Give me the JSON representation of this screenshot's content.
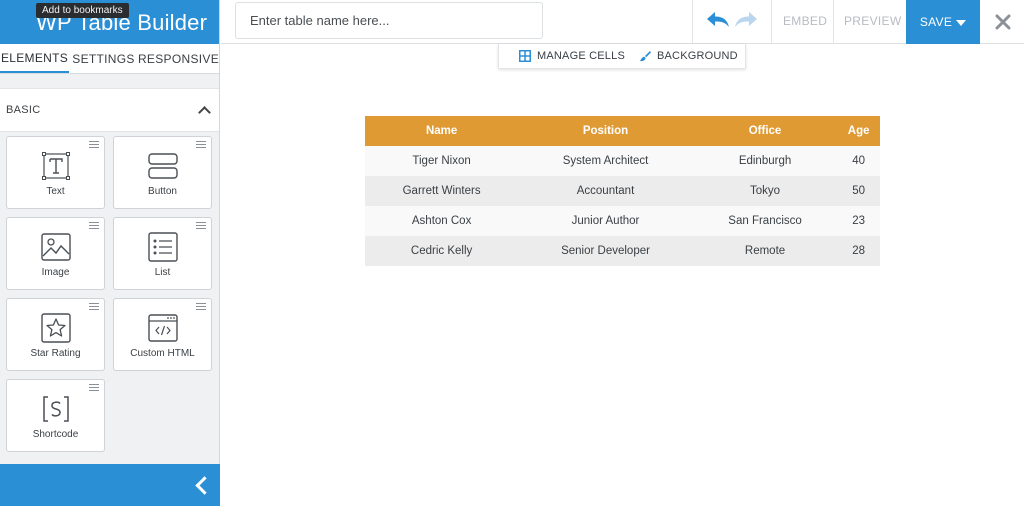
{
  "sidebar": {
    "title": "WP Table Builder",
    "tooltip": "Add to bookmarks",
    "tabs": [
      {
        "label": "ELEMENTS"
      },
      {
        "label": "SETTINGS"
      },
      {
        "label": "RESPONSIVE"
      }
    ],
    "section_label": "BASIC",
    "elements": [
      {
        "label": "Text",
        "icon": "text-icon"
      },
      {
        "label": "Button",
        "icon": "button-icon"
      },
      {
        "label": "Image",
        "icon": "image-icon"
      },
      {
        "label": "List",
        "icon": "list-icon"
      },
      {
        "label": "Star Rating",
        "icon": "star-icon"
      },
      {
        "label": "Custom HTML",
        "icon": "code-icon"
      },
      {
        "label": "Shortcode",
        "icon": "shortcode-icon"
      }
    ]
  },
  "topbar": {
    "name_placeholder": "Enter table name here...",
    "embed_label": "EMBED",
    "preview_label": "PREVIEW",
    "save_label": "SAVE"
  },
  "cell_toolbar": {
    "manage_cells_label": "MANAGE CELLS",
    "background_label": "BACKGROUND"
  },
  "table": {
    "headers": [
      "Name",
      "Position",
      "Office",
      "Age"
    ],
    "rows": [
      [
        "Tiger Nixon",
        "System Architect",
        "Edinburgh",
        "40"
      ],
      [
        "Garrett Winters",
        "Accountant",
        "Tokyo",
        "50"
      ],
      [
        "Ashton Cox",
        "Junior Author",
        "San Francisco",
        "23"
      ],
      [
        "Cedric Kelly",
        "Senior Developer",
        "Remote",
        "28"
      ]
    ]
  },
  "colors": {
    "brand_blue": "#2b8fd6",
    "header_orange": "#e09a34"
  }
}
